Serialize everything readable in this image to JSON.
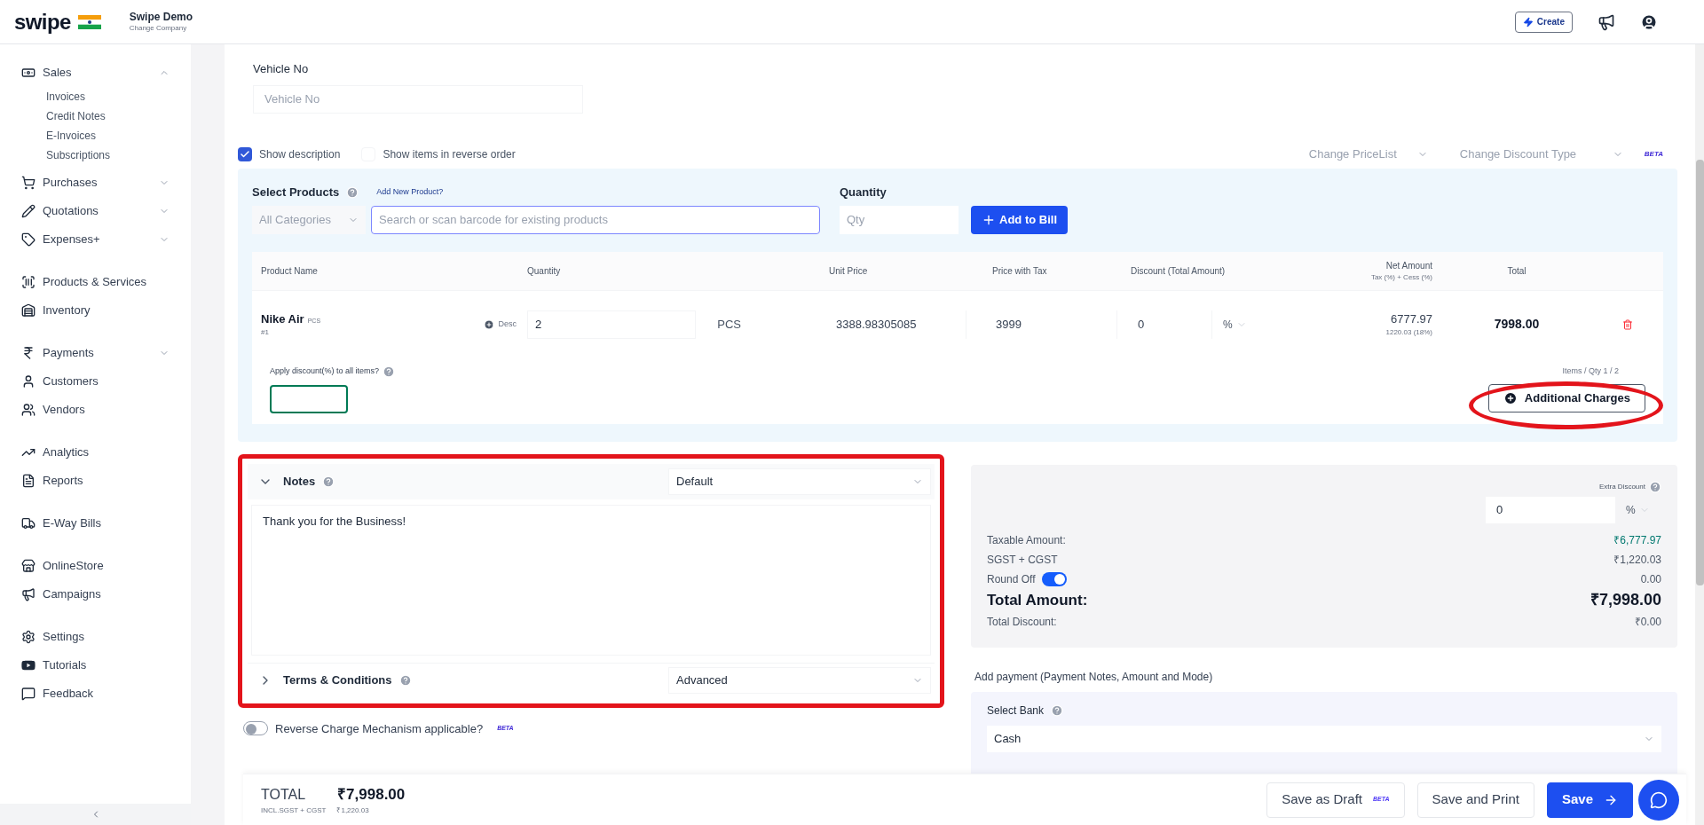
{
  "header": {
    "brand": "swipe",
    "company": "Swipe Demo",
    "change_company": "Change Company",
    "create_button": "Create"
  },
  "sidebar": {
    "sections": [
      {
        "items": [
          {
            "label": "Sales",
            "expanded": true,
            "children": [
              {
                "label": "Invoices"
              },
              {
                "label": "Credit Notes"
              },
              {
                "label": "E-Invoices"
              },
              {
                "label": "Subscriptions"
              }
            ]
          },
          {
            "label": "Purchases",
            "expanded": false
          },
          {
            "label": "Quotations",
            "expanded": false
          },
          {
            "label": "Expenses+",
            "expanded": false
          }
        ]
      },
      {
        "items": [
          {
            "label": "Products & Services"
          },
          {
            "label": "Inventory"
          }
        ]
      },
      {
        "items": [
          {
            "label": "Payments",
            "expanded": false
          },
          {
            "label": "Customers"
          },
          {
            "label": "Vendors"
          }
        ]
      },
      {
        "items": [
          {
            "label": "Analytics"
          },
          {
            "label": "Reports"
          }
        ]
      },
      {
        "items": [
          {
            "label": "E-Way Bills"
          }
        ]
      },
      {
        "items": [
          {
            "label": "OnlineStore"
          },
          {
            "label": "Campaigns"
          }
        ]
      },
      {
        "items": [
          {
            "label": "Settings"
          },
          {
            "label": "Tutorials"
          },
          {
            "label": "Feedback"
          }
        ]
      }
    ]
  },
  "vehicle": {
    "label": "Vehicle No",
    "placeholder": "Vehicle No"
  },
  "options": [
    {
      "label": "Show description",
      "checked": true
    },
    {
      "label": "Show items in reverse order",
      "checked": false
    }
  ],
  "pricelist_select": "Change PriceList",
  "discount_type_select": "Change Discount Type",
  "beta_tag": "BETA",
  "product_picker": {
    "label": "Select Products",
    "add_new": "Add New Product?",
    "category": "All Categories",
    "search_placeholder": "Search or scan barcode for existing products",
    "quantity_label": "Quantity",
    "quantity_placeholder": "Qty",
    "add_button": "Add to Bill"
  },
  "table": {
    "columns": [
      {
        "label": "Product Name"
      },
      {
        "label": "Quantity"
      },
      {
        "label": "Unit Price"
      },
      {
        "label": "Price with Tax"
      },
      {
        "label": "Discount (Total Amount)"
      },
      {
        "label": "Net Amount",
        "sub": "Tax (%) + Cess (%)"
      },
      {
        "label": "Total"
      }
    ],
    "rows": [
      {
        "name": "Nike Air",
        "unit_tag": "PCS",
        "index": "#1",
        "desc_button": "Desc",
        "quantity": "2",
        "quantity_unit": "PCS",
        "unit_price": "3388.98305085",
        "price_with_tax": "3999",
        "discount": "0",
        "discount_type": "%",
        "net_amount": "6777.97",
        "tax": "1220.03 (18%)",
        "total": "7998.00"
      }
    ]
  },
  "items_count": "Items / Qty 1 / 2",
  "apply_discount_label": "Apply discount(%) to all items?",
  "additional_charges_button": "Additional Charges",
  "notes_sections": [
    {
      "title": "Notes",
      "expanded": true,
      "template": "Default",
      "text": "Thank you for the Business!"
    },
    {
      "title": "Terms & Conditions",
      "expanded": false,
      "template": "Advanced"
    }
  ],
  "summary": {
    "extra_discount_label": "Extra Discount",
    "extra_discount": "0",
    "extra_discount_type": "%",
    "rows": [
      {
        "kind": "plain",
        "label": "Taxable Amount:",
        "value": "₹6,777.97"
      },
      {
        "kind": "plain",
        "label": "SGST + CGST",
        "value": "₹1,220.03"
      },
      {
        "kind": "toggle",
        "label": "Round Off",
        "on": true,
        "value": "0.00"
      },
      {
        "kind": "total",
        "label": "Total Amount:",
        "value": "₹7,998.00"
      },
      {
        "kind": "plain",
        "label": "Total Discount:",
        "value": "₹0.00"
      }
    ]
  },
  "payment": {
    "title": "Add payment (Payment Notes, Amount and Mode)",
    "bank_label": "Select Bank",
    "bank": "Cash"
  },
  "reverse_charge": {
    "label": "Reverse Charge Mechanism applicable?",
    "on": false,
    "beta_tag": "BETA"
  },
  "footer": {
    "total_label": "TOTAL",
    "total": "₹7,998.00",
    "tax_label": "INCL.SGST + CGST",
    "tax": "₹1,220.03",
    "buttons": [
      {
        "label": "Save as Draft",
        "kind": "draft",
        "beta_tag": "BETA"
      },
      {
        "label": "Save and Print",
        "kind": "outline"
      },
      {
        "label": "Save",
        "kind": "primary"
      }
    ]
  }
}
